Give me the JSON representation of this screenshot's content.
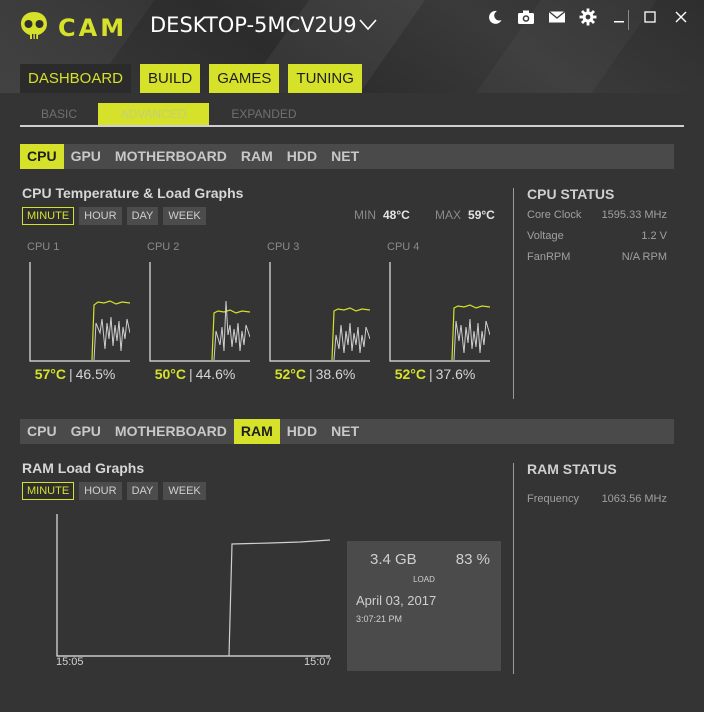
{
  "app": {
    "logo_text": "CAM",
    "device_name": "DESKTOP-5MCV2U9"
  },
  "window_icons": [
    "moon-icon",
    "camera-icon",
    "mail-icon",
    "gear-icon",
    "minimize-icon",
    "maximize-icon",
    "close-icon"
  ],
  "main_tabs": [
    {
      "label": "DASHBOARD",
      "active": true
    },
    {
      "label": "BUILD",
      "active": false
    },
    {
      "label": "GAMES",
      "active": false
    },
    {
      "label": "TUNING",
      "active": false
    }
  ],
  "sub_tabs": [
    {
      "label": "BASIC",
      "active": false
    },
    {
      "label": "ADVANCED",
      "active": true
    },
    {
      "label": "EXPANDED",
      "active": false
    }
  ],
  "component_tabs": [
    "CPU",
    "GPU",
    "MOTHERBOARD",
    "RAM",
    "HDD",
    "NET"
  ],
  "cpu_panel": {
    "active_tab": "CPU",
    "title": "CPU Temperature & Load Graphs",
    "ranges": [
      "MINUTE",
      "HOUR",
      "DAY",
      "WEEK"
    ],
    "active_range": "MINUTE",
    "min_label": "MIN",
    "min_value": "48°C",
    "max_label": "MAX",
    "max_value": "59°C",
    "cores": [
      {
        "label": "CPU 1",
        "temp": "57°C",
        "load": "46.5%",
        "sep": "|"
      },
      {
        "label": "CPU 2",
        "temp": "50°C",
        "load": "44.6%",
        "sep": "|"
      },
      {
        "label": "CPU 3",
        "temp": "52°C",
        "load": "38.6%",
        "sep": "|"
      },
      {
        "label": "CPU 4",
        "temp": "52°C",
        "load": "37.6%",
        "sep": "|"
      }
    ],
    "status": {
      "title": "CPU STATUS",
      "rows": [
        {
          "label": "Core Clock",
          "value": "1595.33 MHz"
        },
        {
          "label": "Voltage",
          "value": "1.2 V"
        },
        {
          "label": "FanRPM",
          "value": "N/A RPM"
        }
      ]
    }
  },
  "ram_panel": {
    "active_tab": "RAM",
    "title": "RAM Load Graphs",
    "ranges": [
      "MINUTE",
      "HOUR",
      "DAY",
      "WEEK"
    ],
    "active_range": "MINUTE",
    "x_start": "15:05",
    "x_end": "15:07",
    "card": {
      "used": "3.4 GB",
      "percent": "83 %",
      "load_label": "LOAD",
      "date": "April 03, 2017",
      "time": "3:07:21 PM"
    },
    "status": {
      "title": "RAM STATUS",
      "rows": [
        {
          "label": "Frequency",
          "value": "1063.56 MHz"
        }
      ]
    }
  },
  "colors": {
    "accent": "#d6e12a",
    "background": "#343434",
    "tab_bar": "#4a4a4a",
    "card": "#4b4b4b"
  }
}
